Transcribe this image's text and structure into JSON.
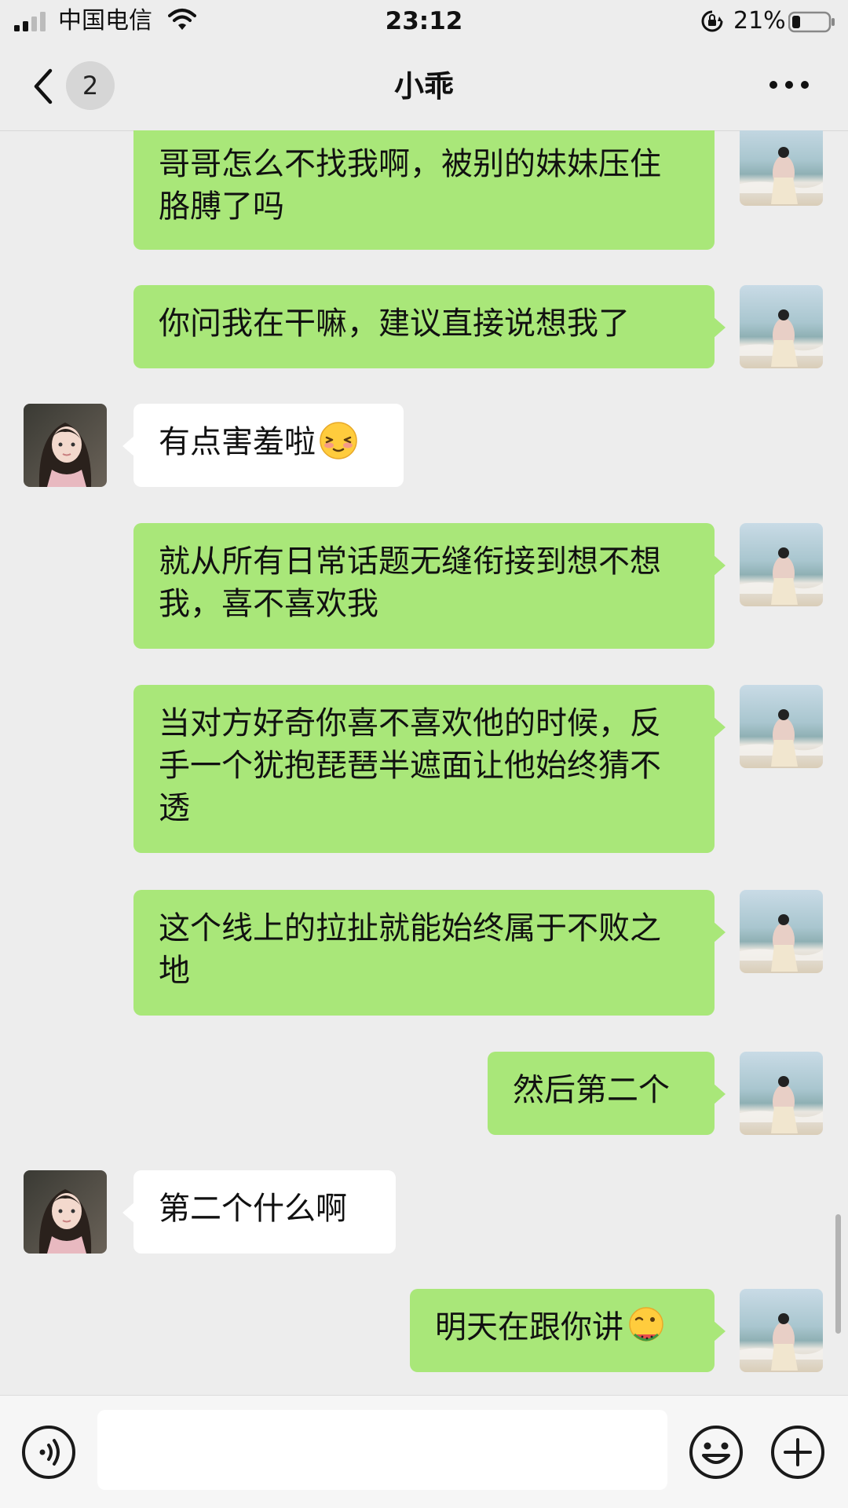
{
  "status_bar": {
    "carrier": "中国电信",
    "time": "23:12",
    "battery": "21%",
    "icons": [
      "signal-icon",
      "wifi-icon",
      "rotation-lock-icon",
      "battery-icon"
    ]
  },
  "nav": {
    "unread_count": "2",
    "title": "小乖",
    "icons": [
      "back-arrow-icon",
      "more-icon"
    ]
  },
  "messages": [
    {
      "sender": "me",
      "text": "哥哥怎么不找我啊，被别的妹妹压住胳膊了吗"
    },
    {
      "sender": "me",
      "text": "你问我在干嘛，建议直接说想我了"
    },
    {
      "sender": "other",
      "text": "有点害羞啦",
      "emoji": "shy-face-emoji"
    },
    {
      "sender": "me",
      "text": "就从所有日常话题无缝衔接到想不想我，喜不喜欢我"
    },
    {
      "sender": "me",
      "text": "当对方好奇你喜不喜欢他的时候，反手一个犹抱琵琶半遮面让他始终猜不透"
    },
    {
      "sender": "me",
      "text": "这个线上的拉扯就能始终属于不败之地"
    },
    {
      "sender": "me",
      "text": "然后第二个"
    },
    {
      "sender": "other",
      "text": "第二个什么啊"
    },
    {
      "sender": "me",
      "text": "明天在跟你讲",
      "emoji": "eating-watermelon-face-emoji"
    }
  ],
  "input_bar": {
    "value": "",
    "icons": [
      "voice-icon",
      "emoji-icon",
      "plus-icon"
    ]
  },
  "colors": {
    "background": "#ededed",
    "my_bubble": "#a9e779",
    "other_bubble": "#ffffff"
  }
}
